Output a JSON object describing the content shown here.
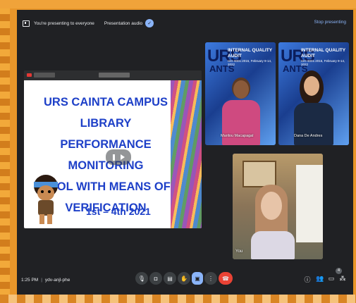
{
  "banner": {
    "presenting_text": "You're presenting to everyone",
    "audio_label": "Presentation audio",
    "stop_label": "Stop presenting"
  },
  "slide": {
    "title_lines": [
      "URS CAINTA CAMPUS LIBRARY",
      "PERFORMANCE MONITORING",
      "TOOL WITH MEANS OF",
      "VERIFICATION"
    ],
    "date_text": "1st – 4th    2021"
  },
  "participants": [
    {
      "name": "Marilou Macapagal",
      "poster_title": "INTERNAL QUALITY AUDIT",
      "poster_sub": "ISO 9001:2015, February 9-14, 2022"
    },
    {
      "name": "Dana De Andres",
      "poster_title": "INTERNAL QUALITY AUDIT",
      "poster_sub": "ISO 9001:2015, February 9-14, 2022"
    },
    {
      "name": "You"
    }
  ],
  "poster_logo": {
    "urs": "URS",
    "ants": "ANTS"
  },
  "bottombar": {
    "time": "1:25 PM",
    "meeting_code": "ydv-anjl-phe",
    "people_count": "4"
  },
  "colors": {
    "accent": "#8ab4f8",
    "leave": "#ea4335",
    "background": "#202124",
    "slide_title": "#1e40c8"
  },
  "icons": [
    "present-screen-icon",
    "check-icon",
    "mic-icon",
    "camera-icon",
    "captions-icon",
    "raise-hand-icon",
    "present-now-icon",
    "more-options-icon",
    "end-call-icon",
    "info-icon",
    "people-icon",
    "chat-icon",
    "activities-icon"
  ]
}
